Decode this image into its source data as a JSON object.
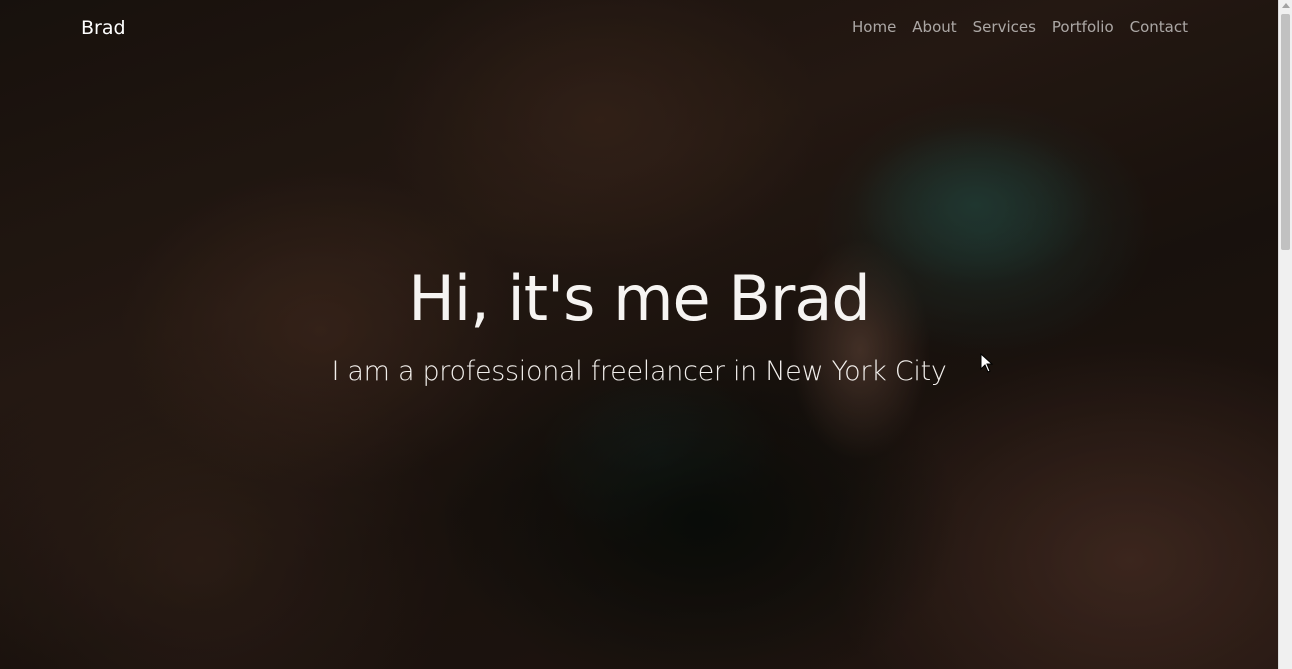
{
  "navbar": {
    "brand": "Brad",
    "links": [
      {
        "label": "Home"
      },
      {
        "label": "About"
      },
      {
        "label": "Services"
      },
      {
        "label": "Portfolio"
      },
      {
        "label": "Contact"
      }
    ]
  },
  "hero": {
    "title": "Hi, it's me Brad",
    "subtitle": "I am a professional freelancer in New York City"
  },
  "colors": {
    "text": "#ffffff",
    "nav_link": "#b3aea9",
    "background_dark": "#1d1510"
  },
  "icons": {
    "cursor": "mouse-pointer-icon"
  }
}
